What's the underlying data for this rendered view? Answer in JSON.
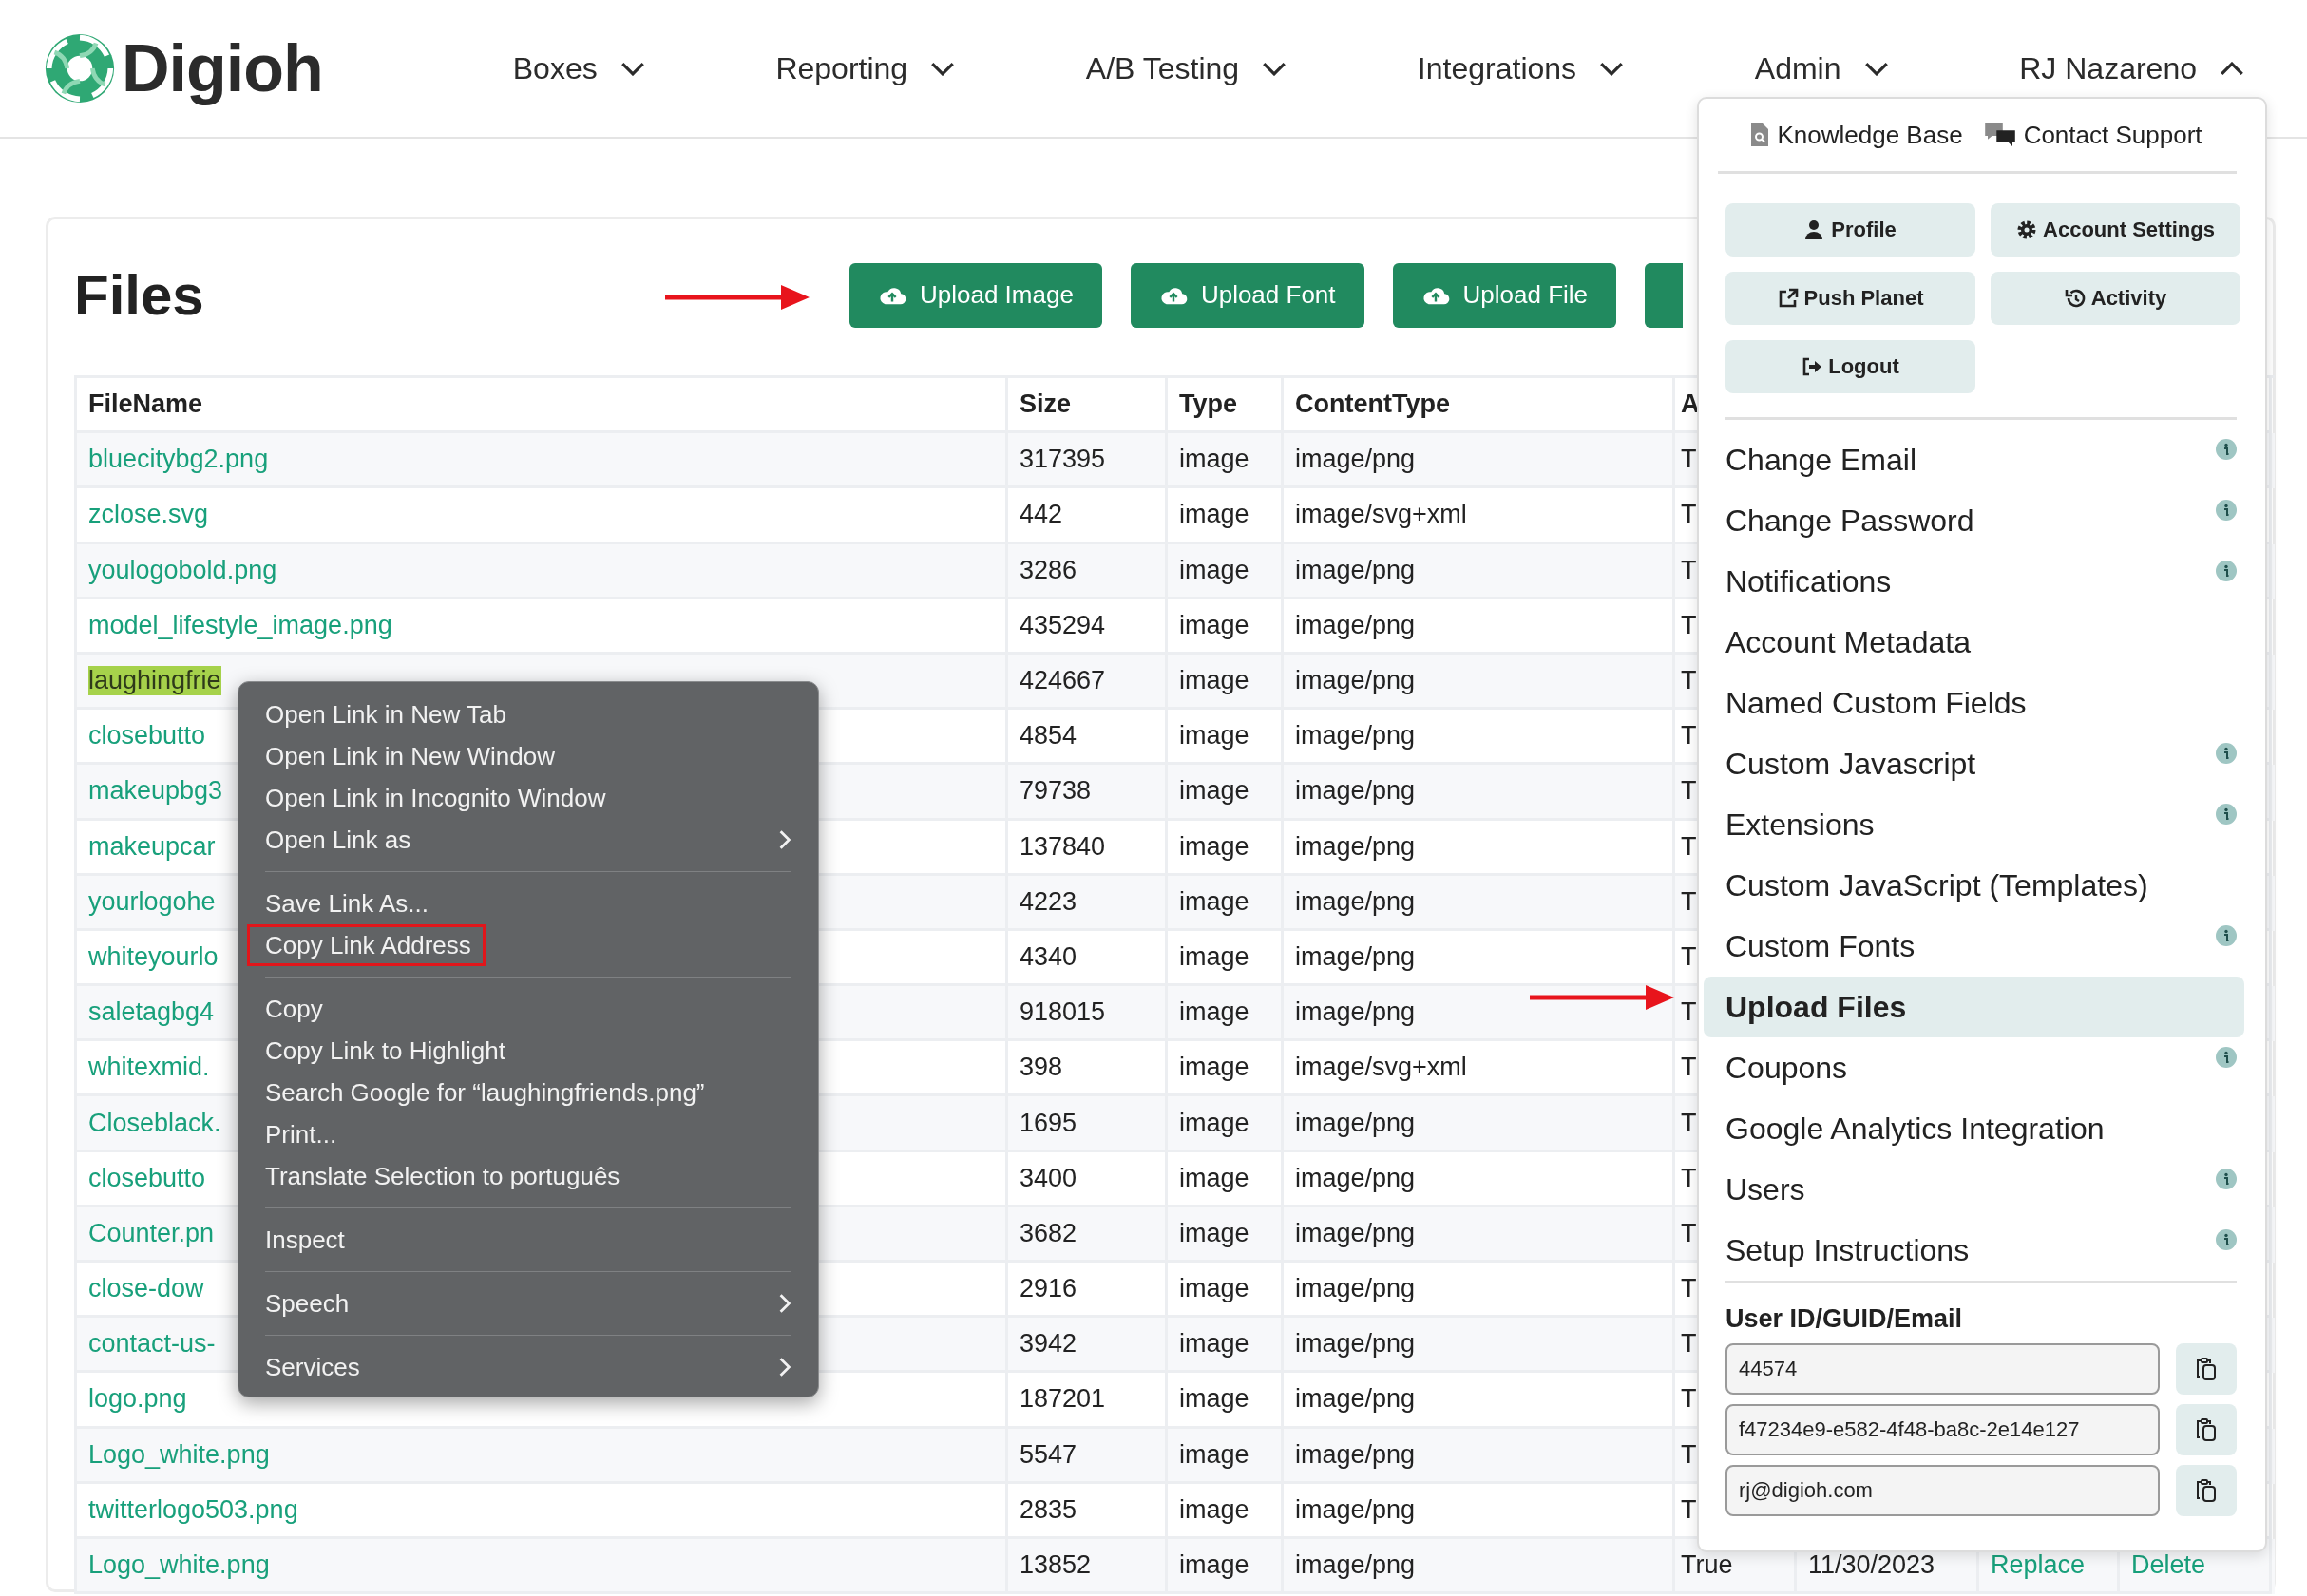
{
  "header": {
    "logo": "Digioh",
    "nav": [
      {
        "label": "Boxes",
        "expanded": false
      },
      {
        "label": "Reporting",
        "expanded": false
      },
      {
        "label": "A/B Testing",
        "expanded": false
      },
      {
        "label": "Integrations",
        "expanded": false
      },
      {
        "label": "Admin",
        "expanded": false
      },
      {
        "label": "RJ Nazareno",
        "expanded": true
      }
    ]
  },
  "page": {
    "title": "Files",
    "buttons": [
      "Upload Image",
      "Upload Font",
      "Upload File"
    ]
  },
  "table": {
    "columns": [
      "FileName",
      "Size",
      "Type",
      "ContentType",
      "A"
    ],
    "rows": [
      {
        "file": "bluecitybg2.png",
        "size": "317395",
        "type": "image",
        "content_type": "image/png",
        "column_5": "T",
        "highlighted": false
      },
      {
        "file": "zclose.svg",
        "size": "442",
        "type": "image",
        "content_type": "image/svg+xml",
        "column_5": "T",
        "highlighted": false
      },
      {
        "file": "youlogobold.png",
        "size": "3286",
        "type": "image",
        "content_type": "image/png",
        "column_5": "T",
        "highlighted": false
      },
      {
        "file": "model_lifestyle_image.png",
        "size": "435294",
        "type": "image",
        "content_type": "image/png",
        "column_5": "T",
        "highlighted": false
      },
      {
        "file": "laughingfrie",
        "size": "424667",
        "type": "image",
        "content_type": "image/png",
        "column_5": "T",
        "highlighted": true
      },
      {
        "file": "closebutto",
        "size": "4854",
        "type": "image",
        "content_type": "image/png",
        "column_5": "T",
        "highlighted": false
      },
      {
        "file": "makeupbg3",
        "size": "79738",
        "type": "image",
        "content_type": "image/png",
        "column_5": "T",
        "highlighted": false
      },
      {
        "file": "makeupcar",
        "size": "137840",
        "type": "image",
        "content_type": "image/png",
        "column_5": "T",
        "highlighted": false
      },
      {
        "file": "yourlogohe",
        "size": "4223",
        "type": "image",
        "content_type": "image/png",
        "column_5": "T",
        "highlighted": false
      },
      {
        "file": "whiteyourlo",
        "size": "4340",
        "type": "image",
        "content_type": "image/png",
        "column_5": "T",
        "highlighted": false
      },
      {
        "file": "saletagbg4",
        "size": "918015",
        "type": "image",
        "content_type": "image/png",
        "column_5": "T",
        "highlighted": false
      },
      {
        "file": "whitexmid.",
        "size": "398",
        "type": "image",
        "content_type": "image/svg+xml",
        "column_5": "T",
        "highlighted": false
      },
      {
        "file": "Closeblack.",
        "size": "1695",
        "type": "image",
        "content_type": "image/png",
        "column_5": "T",
        "highlighted": false
      },
      {
        "file": "closebutto",
        "size": "3400",
        "type": "image",
        "content_type": "image/png",
        "column_5": "T",
        "highlighted": false
      },
      {
        "file": "Counter.pn",
        "size": "3682",
        "type": "image",
        "content_type": "image/png",
        "column_5": "T",
        "highlighted": false
      },
      {
        "file": "close-dow",
        "size": "2916",
        "type": "image",
        "content_type": "image/png",
        "column_5": "T",
        "highlighted": false
      },
      {
        "file": "contact-us-",
        "size": "3942",
        "type": "image",
        "content_type": "image/png",
        "column_5": "T",
        "highlighted": false
      },
      {
        "file": "logo.png",
        "size": "187201",
        "type": "image",
        "content_type": "image/png",
        "column_5": "T",
        "highlighted": false
      },
      {
        "file": "Logo_white.png",
        "size": "5547",
        "type": "image",
        "content_type": "image/png",
        "column_5": "T",
        "highlighted": false
      },
      {
        "file": "twitterlogo503.png",
        "size": "2835",
        "type": "image",
        "content_type": "image/png",
        "column_5": "T",
        "highlighted": false
      },
      {
        "file": "Logo_white.png",
        "size": "13852",
        "type": "image",
        "content_type": "image/png",
        "column_5": "True",
        "date": "11/30/2023",
        "actions": [
          "Replace",
          "Delete"
        ],
        "highlighted": false
      }
    ]
  },
  "context_menu": {
    "items": [
      {
        "kind": "item",
        "label": "Open Link in New Tab",
        "submenu": false,
        "outlined": false
      },
      {
        "kind": "item",
        "label": "Open Link in New Window",
        "submenu": false,
        "outlined": false
      },
      {
        "kind": "item",
        "label": "Open Link in Incognito Window",
        "submenu": false,
        "outlined": false
      },
      {
        "kind": "item",
        "label": "Open Link as",
        "submenu": true,
        "outlined": false
      },
      {
        "kind": "separator"
      },
      {
        "kind": "item",
        "label": "Save Link As...",
        "submenu": false,
        "outlined": false
      },
      {
        "kind": "item",
        "label": "Copy Link Address",
        "submenu": false,
        "outlined": true
      },
      {
        "kind": "separator"
      },
      {
        "kind": "item",
        "label": "Copy",
        "submenu": false,
        "outlined": false
      },
      {
        "kind": "item",
        "label": "Copy Link to Highlight",
        "submenu": false,
        "outlined": false
      },
      {
        "kind": "item",
        "label": "Search Google for “laughingfriends.png”",
        "submenu": false,
        "outlined": false
      },
      {
        "kind": "item",
        "label": "Print...",
        "submenu": false,
        "outlined": false
      },
      {
        "kind": "item",
        "label": "Translate Selection to português",
        "submenu": false,
        "outlined": false
      },
      {
        "kind": "separator"
      },
      {
        "kind": "item",
        "label": "Inspect",
        "submenu": false,
        "outlined": false
      },
      {
        "kind": "separator"
      },
      {
        "kind": "item",
        "label": "Speech",
        "submenu": true,
        "outlined": false
      },
      {
        "kind": "separator"
      },
      {
        "kind": "item",
        "label": "Services",
        "submenu": true,
        "outlined": false
      }
    ]
  },
  "account_menu": {
    "links": [
      {
        "kind": "document",
        "label": "Knowledge Base"
      },
      {
        "kind": "chat",
        "label": "Contact Support"
      }
    ],
    "buttons": [
      {
        "kind": "user",
        "label": "Profile"
      },
      {
        "kind": "gear",
        "label": "Account Settings"
      },
      {
        "kind": "external",
        "label": "Push Planet"
      },
      {
        "kind": "history",
        "label": "Activity"
      },
      {
        "kind": "logout",
        "label": "Logout"
      }
    ],
    "items": [
      {
        "label": "Change Email",
        "info": true,
        "selected": false
      },
      {
        "label": "Change Password",
        "info": true,
        "selected": false
      },
      {
        "label": "Notifications",
        "info": true,
        "selected": false
      },
      {
        "label": "Account Metadata",
        "info": false,
        "selected": false
      },
      {
        "label": "Named Custom Fields",
        "info": false,
        "selected": false
      },
      {
        "label": "Custom Javascript",
        "info": true,
        "selected": false
      },
      {
        "label": "Extensions",
        "info": true,
        "selected": false
      },
      {
        "label": "Custom JavaScript (Templates)",
        "info": false,
        "selected": false
      },
      {
        "label": "Custom Fonts",
        "info": true,
        "selected": false
      },
      {
        "label": "Upload Files",
        "info": false,
        "selected": true
      },
      {
        "label": "Coupons",
        "info": true,
        "selected": false
      },
      {
        "label": "Google Analytics Integration",
        "info": false,
        "selected": false
      },
      {
        "label": "Users",
        "info": true,
        "selected": false
      },
      {
        "label": "Setup Instructions",
        "info": true,
        "selected": false
      }
    ],
    "id_label": "User ID/GUID/Email",
    "fields": [
      "44574",
      "f47234e9-e582-4f48-ba8c-2e14e127",
      "rj@digioh.com"
    ]
  }
}
